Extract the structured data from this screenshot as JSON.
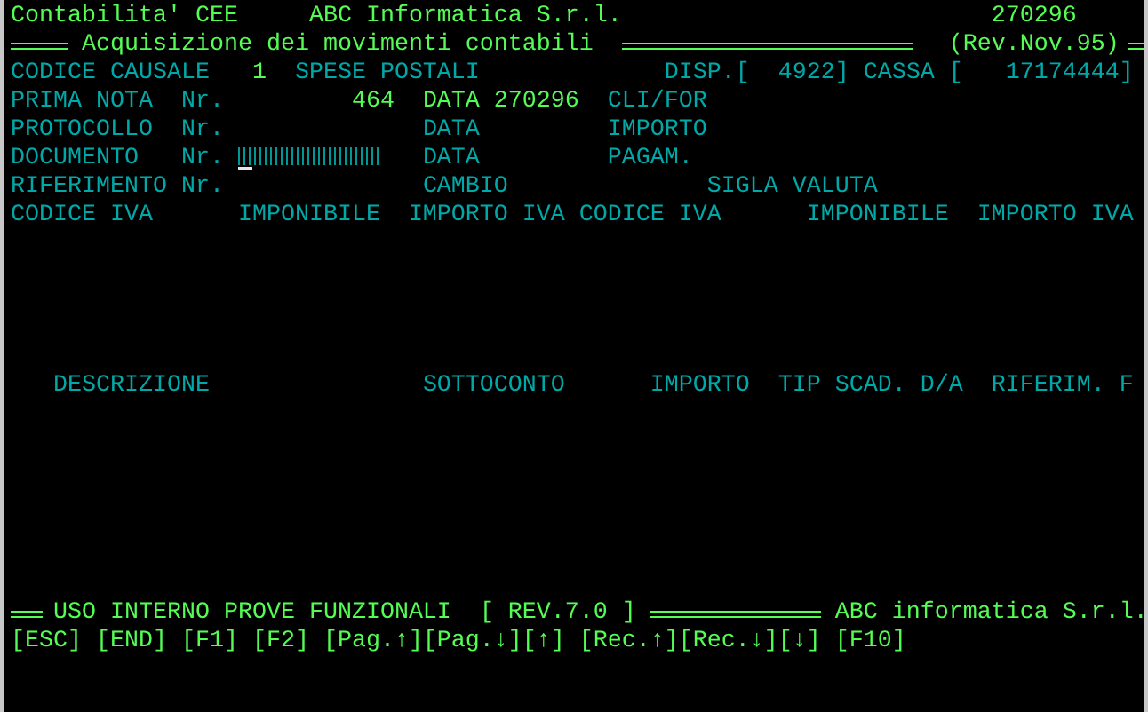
{
  "rows": [
    {
      "items": [
        {
          "text": "Contabilita' CEE",
          "kind": "info"
        },
        {
          "text": "ABC Informatica S.r.l.",
          "kind": "info"
        },
        {
          "text": "270296",
          "kind": "info"
        }
      ]
    },
    {
      "items": [
        {
          "kind": "rule"
        },
        {
          "text": "Acquisizione dei movimenti contabili",
          "kind": "info"
        },
        {
          "kind": "rule"
        },
        {
          "text": "(Rev.Nov.95)",
          "kind": "info"
        },
        {
          "kind": "rule"
        }
      ]
    },
    {
      "items": [
        {
          "text": "CODICE CAUSALE",
          "kind": "label"
        },
        {
          "text": "1",
          "kind": "info"
        },
        {
          "text": "SPESE POSTALI",
          "kind": "label"
        },
        {
          "text": "DISP.[  4922]",
          "kind": "label"
        },
        {
          "text": "CASSA [   17174444]",
          "kind": "label"
        }
      ]
    },
    {
      "items": [
        {
          "text": "PRIMA NOTA",
          "kind": "label"
        },
        {
          "text": "Nr.",
          "kind": "label"
        },
        {
          "text": "464",
          "kind": "info"
        },
        {
          "text": "DATA 270296",
          "kind": "info"
        },
        {
          "text": "CLI/FOR",
          "kind": "label"
        }
      ]
    },
    {
      "items": [
        {
          "text": "PROTOCOLLO",
          "kind": "label"
        },
        {
          "text": "Nr.",
          "kind": "label"
        },
        {
          "text": "DATA",
          "kind": "label"
        },
        {
          "text": "IMPORTO",
          "kind": "label"
        }
      ]
    },
    {
      "items": [
        {
          "text": "DOCUMENTO",
          "kind": "label"
        },
        {
          "text": "Nr.",
          "kind": "label"
        },
        {
          "kind": "field"
        },
        {
          "text": "DATA",
          "kind": "label"
        },
        {
          "text": "PAGAM.",
          "kind": "label"
        }
      ]
    },
    {
      "items": [
        {
          "text": "RIFERIMENTO",
          "kind": "label"
        },
        {
          "text": "Nr.",
          "kind": "label"
        },
        {
          "text": "CAMBIO",
          "kind": "label"
        },
        {
          "text": "SIGLA VALUTA",
          "kind": "label"
        }
      ]
    },
    {
      "items": [
        {
          "text": "CODICE IVA",
          "kind": "label"
        },
        {
          "text": "IMPONIBILE",
          "kind": "label"
        },
        {
          "text": "IMPORTO IVA",
          "kind": "label"
        },
        {
          "text": "CODICE IVA",
          "kind": "label"
        },
        {
          "text": "IMPONIBILE",
          "kind": "label"
        },
        {
          "text": "IMPORTO IVA",
          "kind": "label"
        }
      ]
    },
    {
      "items": [
        {
          "text": "DESCRIZIONE",
          "kind": "label"
        },
        {
          "text": "SOTTOCONTO",
          "kind": "label"
        },
        {
          "text": "IMPORTO",
          "kind": "label"
        },
        {
          "text": "TIP",
          "kind": "label"
        },
        {
          "text": "SCAD.",
          "kind": "label"
        },
        {
          "text": "D/A",
          "kind": "label"
        },
        {
          "text": "RIFERIM.",
          "kind": "label"
        },
        {
          "text": "F",
          "kind": "label"
        }
      ]
    },
    {
      "items": [
        {
          "kind": "rule"
        },
        {
          "text": "USO INTERNO PROVE FUNZIONALI",
          "kind": "info"
        },
        {
          "text": "[ REV.7.0 ]",
          "kind": "info"
        },
        {
          "kind": "rule"
        },
        {
          "text": "ABC informatica S.r.l.",
          "kind": "info"
        }
      ]
    },
    {
      "items": [
        {
          "text": "[ESC]",
          "kind": "key"
        },
        {
          "text": "[END]",
          "kind": "key"
        },
        {
          "text": "[F1]",
          "kind": "key"
        },
        {
          "text": "[F2]",
          "kind": "key"
        },
        {
          "text": "[Pag.↑]",
          "kind": "key"
        },
        {
          "text": "[Pag.↓]",
          "kind": "key"
        },
        {
          "text": "[↑]",
          "kind": "key"
        },
        {
          "text": "[Rec.↑]",
          "kind": "key"
        },
        {
          "text": "[Rec.↓]",
          "kind": "key"
        },
        {
          "text": "[↓]",
          "kind": "key"
        },
        {
          "text": "[F10]",
          "kind": "key"
        }
      ]
    }
  ]
}
